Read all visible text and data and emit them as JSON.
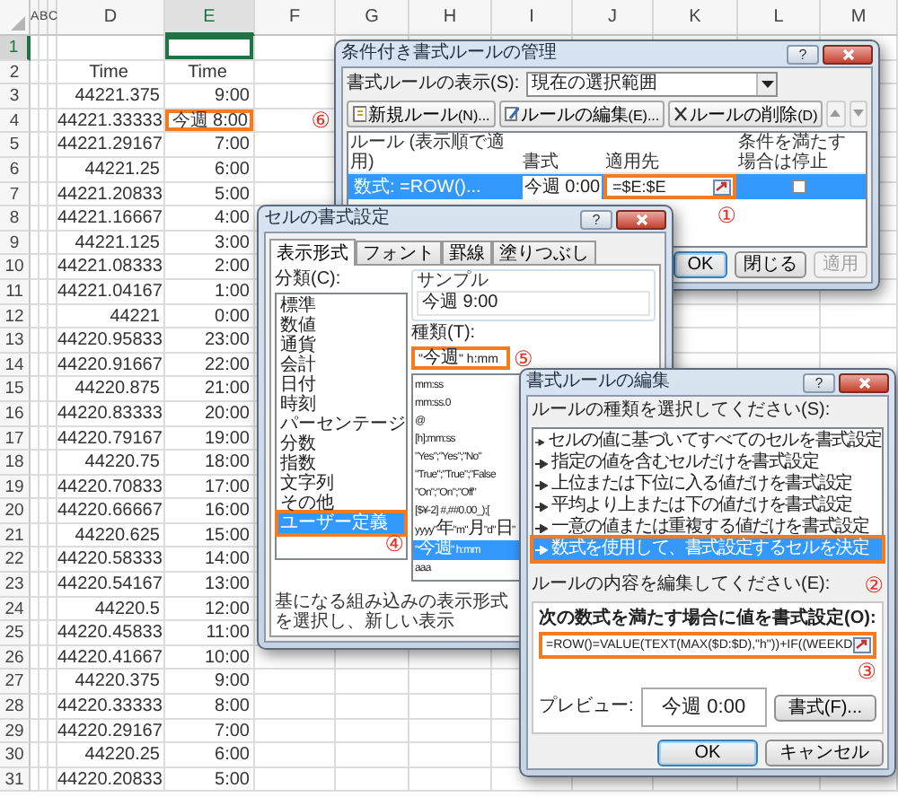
{
  "sheet": {
    "columns": [
      {
        "label": "A",
        "selected": false
      },
      {
        "label": "B",
        "selected": false
      },
      {
        "label": "C",
        "selected": false
      },
      {
        "label": "D",
        "selected": false
      },
      {
        "label": "E",
        "selected": true
      },
      {
        "label": "F",
        "selected": false
      },
      {
        "label": "G",
        "selected": false
      },
      {
        "label": "H",
        "selected": false
      },
      {
        "label": "I",
        "selected": false
      },
      {
        "label": "J",
        "selected": false
      },
      {
        "label": "K",
        "selected": false
      },
      {
        "label": "L",
        "selected": false
      },
      {
        "label": "M",
        "selected": false
      }
    ],
    "rows": [
      {
        "number": "1",
        "kind": "data",
        "selected": true,
        "active": true
      },
      {
        "number": "2",
        "kind": "header",
        "selected": false,
        "d": "Time",
        "e": "Time"
      },
      {
        "number": "3",
        "kind": "data",
        "selected": false,
        "d": "44221.375",
        "e": "9:00"
      },
      {
        "number": "4",
        "kind": "data",
        "selected": false,
        "d": "44221.33333",
        "e": "今週 8:00",
        "highlighted": true,
        "callout": "⑥"
      },
      {
        "number": "5",
        "kind": "data",
        "selected": false,
        "d": "44221.29167",
        "e": "7:00"
      },
      {
        "number": "6",
        "kind": "data",
        "selected": false,
        "d": "44221.25",
        "e": "6:00"
      },
      {
        "number": "7",
        "kind": "data",
        "selected": false,
        "d": "44221.20833",
        "e": "5:00"
      },
      {
        "number": "8",
        "kind": "data",
        "selected": false,
        "d": "44221.16667",
        "e": "4:00"
      },
      {
        "number": "9",
        "kind": "data",
        "selected": false,
        "d": "44221.125",
        "e": "3:00"
      },
      {
        "number": "10",
        "kind": "data",
        "selected": false,
        "d": "44221.08333",
        "e": "2:00"
      },
      {
        "number": "11",
        "kind": "data",
        "selected": false,
        "d": "44221.04167",
        "e": "1:00"
      },
      {
        "number": "12",
        "kind": "data",
        "selected": false,
        "d": "44221",
        "e": "0:00"
      },
      {
        "number": "13",
        "kind": "data",
        "selected": false,
        "d": "44220.95833",
        "e": "23:00"
      },
      {
        "number": "14",
        "kind": "data",
        "selected": false,
        "d": "44220.91667",
        "e": "22:00"
      },
      {
        "number": "15",
        "kind": "data",
        "selected": false,
        "d": "44220.875",
        "e": "21:00"
      },
      {
        "number": "16",
        "kind": "data",
        "selected": false,
        "d": "44220.83333",
        "e": "20:00"
      },
      {
        "number": "17",
        "kind": "data",
        "selected": false,
        "d": "44220.79167",
        "e": "19:00"
      },
      {
        "number": "18",
        "kind": "data",
        "selected": false,
        "d": "44220.75",
        "e": "18:00"
      },
      {
        "number": "19",
        "kind": "data",
        "selected": false,
        "d": "44220.70833",
        "e": "17:00"
      },
      {
        "number": "20",
        "kind": "data",
        "selected": false,
        "d": "44220.66667",
        "e": "16:00"
      },
      {
        "number": "21",
        "kind": "data",
        "selected": false,
        "d": "44220.625",
        "e": "15:00"
      },
      {
        "number": "22",
        "kind": "data",
        "selected": false,
        "d": "44220.58333",
        "e": "14:00"
      },
      {
        "number": "23",
        "kind": "data",
        "selected": false,
        "d": "44220.54167",
        "e": "13:00"
      },
      {
        "number": "24",
        "kind": "data",
        "selected": false,
        "d": "44220.5",
        "e": "12:00"
      },
      {
        "number": "25",
        "kind": "data",
        "selected": false,
        "d": "44220.45833",
        "e": "11:00"
      },
      {
        "number": "26",
        "kind": "data",
        "selected": false,
        "d": "44220.41667",
        "e": "10:00"
      },
      {
        "number": "27",
        "kind": "data",
        "selected": false,
        "d": "44220.375",
        "e": "9:00"
      },
      {
        "number": "28",
        "kind": "data",
        "selected": false,
        "d": "44220.33333",
        "e": "8:00"
      },
      {
        "number": "29",
        "kind": "data",
        "selected": false,
        "d": "44220.29167",
        "e": "7:00"
      },
      {
        "number": "30",
        "kind": "data",
        "selected": false,
        "d": "44220.25",
        "e": "6:00"
      },
      {
        "number": "31",
        "kind": "data",
        "selected": false,
        "d": "44220.20833",
        "e": "5:00"
      }
    ]
  },
  "rules_manager": {
    "title": "条件付き書式ルールの管理",
    "help": "?",
    "show_label": "書式ルールの表示(S):",
    "show_value": "現在の選択範囲",
    "toolbar": [
      {
        "kind": "new",
        "label": "新規ルール(N)...",
        "disabled": false
      },
      {
        "kind": "edit",
        "label": "ルールの編集(E)...",
        "disabled": false
      },
      {
        "kind": "delete",
        "label": "ルールの削除(D)",
        "disabled": false
      },
      {
        "kind": "up",
        "disabled": true
      },
      {
        "kind": "down",
        "disabled": true
      }
    ],
    "columns": [
      "ルール (表示順で適用)",
      "書式",
      "適用先",
      "条件を満たす場合は停止"
    ],
    "rules": [
      {
        "rule": "数式: =ROW()...",
        "format": "今週 0:00",
        "applies_to": "=$E:$E",
        "stop": false,
        "selected": true,
        "highlighted": true,
        "callout": "①"
      }
    ],
    "buttons": [
      {
        "label": "OK",
        "default": true,
        "disabled": false
      },
      {
        "label": "閉じる",
        "default": false,
        "disabled": false
      },
      {
        "label": "適用",
        "default": false,
        "disabled": true
      }
    ]
  },
  "format_cells": {
    "title": "セルの書式設定",
    "help": "?",
    "tabs": [
      {
        "label": "表示形式",
        "selected": true
      },
      {
        "label": "フォント",
        "selected": false
      },
      {
        "label": "罫線",
        "selected": false
      },
      {
        "label": "塗りつぶし",
        "selected": false
      }
    ],
    "category_label": "分類(C):",
    "categories": [
      {
        "label": "標準",
        "selected": false,
        "highlighted": false
      },
      {
        "label": "数値",
        "selected": false,
        "highlighted": false
      },
      {
        "label": "通貨",
        "selected": false,
        "highlighted": false
      },
      {
        "label": "会計",
        "selected": false,
        "highlighted": false
      },
      {
        "label": "日付",
        "selected": false,
        "highlighted": false
      },
      {
        "label": "時刻",
        "selected": false,
        "highlighted": false
      },
      {
        "label": "パーセンテージ",
        "selected": false,
        "highlighted": false
      },
      {
        "label": "分数",
        "selected": false,
        "highlighted": false
      },
      {
        "label": "指数",
        "selected": false,
        "highlighted": false
      },
      {
        "label": "文字列",
        "selected": false,
        "highlighted": false
      },
      {
        "label": "その他",
        "selected": false,
        "highlighted": false
      },
      {
        "label": "ユーザー定義",
        "selected": true,
        "highlighted": true,
        "callout": "④"
      }
    ],
    "sample_label": "サンプル",
    "sample": "今週 9:00",
    "type_label": "種類(T):",
    "type_field": {
      "value": "\"今週\" h:mm",
      "highlighted": true,
      "callout": "⑤"
    },
    "types": [
      {
        "label": "mm:ss",
        "selected": false
      },
      {
        "label": "mm:ss.0",
        "selected": false
      },
      {
        "label": "@",
        "selected": false
      },
      {
        "label": "[h]:mm:ss",
        "selected": false
      },
      {
        "label": "\"Yes\";\"Yes\";\"No\"",
        "selected": false
      },
      {
        "label": "\"True\";\"True\";\"False",
        "selected": false
      },
      {
        "label": "\"On\";\"On\";\"Off\"",
        "selected": false
      },
      {
        "label": "[$¥-2] #,##0.00_);[",
        "selected": false
      },
      {
        "label": "yyyy\"年\"m\"月\"d\"日\"",
        "selected": false
      },
      {
        "label": "\"今週\" h:mm",
        "selected": true
      },
      {
        "label": "aaa",
        "selected": false
      }
    ],
    "hint": "基になる組み込みの表示形式を選択し、新しい表示"
  },
  "edit_rule": {
    "title": "書式ルールの編集",
    "help": "?",
    "type_label": "ルールの種類を選択してください(S):",
    "rule_types": [
      {
        "label": "セルの値に基づいてすべてのセルを書式設定",
        "selected": false,
        "highlighted": false
      },
      {
        "label": "指定の値を含むセルだけを書式設定",
        "selected": false,
        "highlighted": false
      },
      {
        "label": "上位または下位に入る値だけを書式設定",
        "selected": false,
        "highlighted": false
      },
      {
        "label": "平均より上または下の値だけを書式設定",
        "selected": false,
        "highlighted": false
      },
      {
        "label": "一意の値または重複する値だけを書式設定",
        "selected": false,
        "highlighted": false
      },
      {
        "label": "数式を使用して、書式設定するセルを決定",
        "selected": true,
        "highlighted": true
      }
    ],
    "content_label": "ルールの内容を編集してください(E):",
    "content_callout": "②",
    "formula_label": "次の数式を満たす場合に値を書式設定(O):",
    "formula": {
      "value": "=ROW()=VALUE(TEXT(MAX($D:$D),\"h\"))+IF((WEEKD",
      "highlighted": true,
      "callout": "③"
    },
    "preview_label": "プレビュー:",
    "preview": "今週 0:00",
    "format_button": "書式(F)...",
    "buttons": [
      {
        "label": "OK",
        "default": true,
        "disabled": false
      },
      {
        "label": "キャンセル",
        "default": false,
        "disabled": false
      }
    ]
  }
}
